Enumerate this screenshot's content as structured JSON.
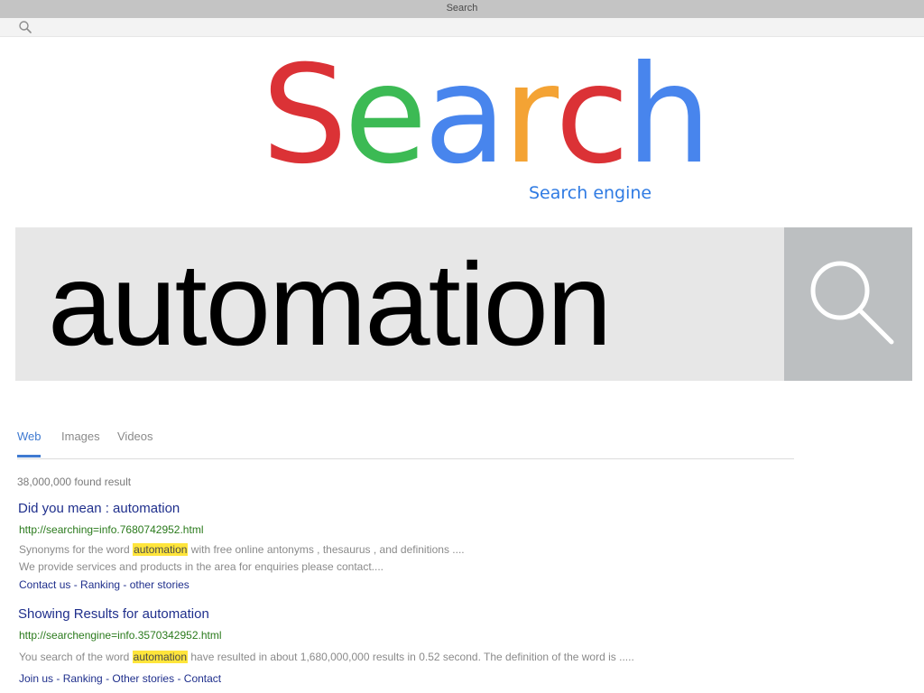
{
  "window": {
    "title": "Search"
  },
  "logo": {
    "letters": [
      {
        "char": "S",
        "color": "#db3236"
      },
      {
        "char": "e",
        "color": "#3cba54"
      },
      {
        "char": "a",
        "color": "#4885ed"
      },
      {
        "char": "r",
        "color": "#f4a334"
      },
      {
        "char": "c",
        "color": "#db3236"
      },
      {
        "char": "h",
        "color": "#4885ed"
      }
    ],
    "tagline": "Search engine"
  },
  "search": {
    "query": "automation",
    "button_icon": "search-icon",
    "top_icon": "search-icon"
  },
  "tabs": [
    {
      "label": "Web",
      "active": true
    },
    {
      "label": "Images",
      "active": false
    },
    {
      "label": "Videos",
      "active": false
    }
  ],
  "results_count": "38,000,000 found result",
  "results": [
    {
      "title": "Did you mean : automation",
      "url": "http://searching=info.7680742952.html",
      "snippet1_before": "Synonyms for the word ",
      "snippet1_highlight": "automation",
      "snippet1_after": " with free online antonyms , thesaurus , and definitions ....",
      "snippet2": "We provide services and products in the area for enquiries please contact....",
      "links": [
        "Contact us",
        "Ranking",
        "other stories"
      ]
    },
    {
      "title": "Showing Results for automation",
      "url": "http://searchengine=info.3570342952.html",
      "snippet1_before": "You search of the word ",
      "snippet1_highlight": "automation",
      "snippet1_after": " have resulted in about 1,680,000,000 results in 0.52 second. The definition of the word is .....",
      "links": [
        "Join us",
        "Ranking",
        "Other stories",
        "Contact"
      ]
    }
  ],
  "link_separator": " - ",
  "colors": {
    "accent_blue": "#3f7ad1",
    "title_blue": "#1f2f8c",
    "url_green": "#2a7a1c",
    "highlight": "#ffe53b"
  }
}
